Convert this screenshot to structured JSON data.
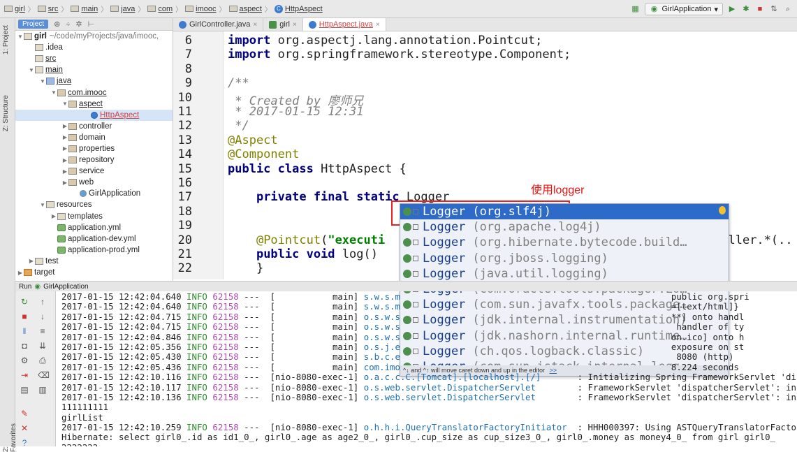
{
  "breadcrumb": [
    "girl",
    "src",
    "main",
    "java",
    "com",
    "imooc",
    "aspect",
    "HttpAspect"
  ],
  "run_config": "GirlApplication",
  "left_tabs": [
    "1: Project",
    "Z: Structure",
    "2: Favorites"
  ],
  "project_panel": {
    "tab": "Project",
    "tree": [
      {
        "label": "girl",
        "suffix": "~/code/myProjects/java/imooc,",
        "icon": "folder",
        "indent": 0,
        "arrow": "▼",
        "bold": true
      },
      {
        "label": ".idea",
        "icon": "folder",
        "indent": 1,
        "arrow": ""
      },
      {
        "label": "src",
        "icon": "folder",
        "indent": 1,
        "arrow": "",
        "underline": true
      },
      {
        "label": "main",
        "icon": "folder",
        "indent": 1,
        "arrow": "▼",
        "underline": true
      },
      {
        "label": "java",
        "icon": "src",
        "indent": 2,
        "arrow": "▼",
        "underline": true
      },
      {
        "label": "com.imooc",
        "icon": "pkg",
        "indent": 3,
        "arrow": "▼",
        "underline": true
      },
      {
        "label": "aspect",
        "icon": "pkg",
        "indent": 4,
        "arrow": "▼",
        "underline": true
      },
      {
        "label": "HttpAspect",
        "icon": "cls",
        "indent": 6,
        "arrow": "",
        "underline": true,
        "selected": true
      },
      {
        "label": "controller",
        "icon": "pkg",
        "indent": 4,
        "arrow": "▶"
      },
      {
        "label": "domain",
        "icon": "pkg",
        "indent": 4,
        "arrow": "▶"
      },
      {
        "label": "properties",
        "icon": "pkg",
        "indent": 4,
        "arrow": "▶"
      },
      {
        "label": "repository",
        "icon": "pkg",
        "indent": 4,
        "arrow": "▶"
      },
      {
        "label": "service",
        "icon": "pkg",
        "indent": 4,
        "arrow": "▶"
      },
      {
        "label": "web",
        "icon": "pkg",
        "indent": 4,
        "arrow": "▶"
      },
      {
        "label": "GirlApplication",
        "icon": "app",
        "indent": 5,
        "arrow": ""
      },
      {
        "label": "resources",
        "icon": "folder",
        "indent": 2,
        "arrow": "▼"
      },
      {
        "label": "templates",
        "icon": "folder",
        "indent": 3,
        "arrow": "▶"
      },
      {
        "label": "application.yml",
        "icon": "yml",
        "indent": 3,
        "arrow": ""
      },
      {
        "label": "application-dev.yml",
        "icon": "yml",
        "indent": 3,
        "arrow": ""
      },
      {
        "label": "application-prod.yml",
        "icon": "yml",
        "indent": 3,
        "arrow": ""
      },
      {
        "label": "test",
        "icon": "folder",
        "indent": 1,
        "arrow": "▶"
      },
      {
        "label": "target",
        "icon": "tgt",
        "indent": 0,
        "arrow": "▶"
      }
    ]
  },
  "editor_tabs": [
    {
      "label": "GirlController.java",
      "icon": "c",
      "active": false
    },
    {
      "label": "girl",
      "icon": "m",
      "active": false
    },
    {
      "label": "HttpAspect.java",
      "icon": "c",
      "active": true
    }
  ],
  "code_lines": [
    {
      "n": "6",
      "html": "<span class='kw'>import</span> org.aspectj.lang.annotation.Pointcut;"
    },
    {
      "n": "7",
      "html": "<span class='kw'>import</span> org.springframework.stereotype.Component;"
    },
    {
      "n": "8",
      "html": ""
    },
    {
      "n": "9",
      "html": "<span class='cm'>/**</span>"
    },
    {
      "n": "10",
      "html": "<span class='cm'> * Created by 廖师兄</span>"
    },
    {
      "n": "11",
      "html": "<span class='cm'> * 2017-01-15 12:31</span>"
    },
    {
      "n": "12",
      "html": "<span class='cm'> */</span>"
    },
    {
      "n": "13",
      "html": "<span class='an'>@Aspect</span>"
    },
    {
      "n": "14",
      "html": "<span class='an'>@Component</span>"
    },
    {
      "n": "15",
      "html": "<span class='kw'>public class</span> HttpAspect {"
    },
    {
      "n": "16",
      "html": ""
    },
    {
      "n": "17",
      "html": "    <span class='kw'>private final static</span> Logger"
    },
    {
      "n": "18",
      "html": ""
    },
    {
      "n": "19",
      "html": ""
    },
    {
      "n": "20",
      "html": "    <span class='an'>@Pointcut</span>(<span class='str'>\"executi</span>                                              roller.*(.."
    },
    {
      "n": "21",
      "html": "    <span class='kw'>public void</span> log()"
    },
    {
      "n": "22",
      "html": "    }"
    }
  ],
  "annotation_text": "使用logger",
  "completion": {
    "items": [
      {
        "name": "Logger",
        "pkg": "(org.slf4j)",
        "selected": true
      },
      {
        "name": "Logger",
        "pkg": "(org.apache.log4j)"
      },
      {
        "name": "Logger",
        "pkg": "(org.hibernate.bytecode.build…"
      },
      {
        "name": "Logger",
        "pkg": "(org.jboss.logging)"
      },
      {
        "name": "Logger",
        "pkg": "(java.util.logging)"
      },
      {
        "name": "Logger",
        "pkg": "(com.oracle.tools.packager.Lo…"
      },
      {
        "name": "Logger",
        "pkg": "(com.sun.javafx.tools.package…"
      },
      {
        "name": "Logger",
        "pkg": "(jdk.internal.instrumentation)"
      },
      {
        "name": "Logger",
        "pkg": "(jdk.nashorn.internal.runtime…"
      },
      {
        "name": "Logger",
        "pkg": "(ch.qos.logback.classic)"
      },
      {
        "name": "Logger",
        "pkg": "(com.sun.istack.internal.logg…"
      }
    ],
    "footer": "^↓ and ^↑ will move caret down and up in the editor",
    "footer_link": ">>"
  },
  "run_panel": {
    "title": "Run",
    "config": "GirlApplication",
    "lines": [
      {
        "ts": "2017-01-15 12:42:04.640",
        "lvl": "INFO",
        "pid": "62158",
        "thread": "---  [           main]",
        "logger": "s.w.s.m",
        "msg": "                                                   public org.spri"
      },
      {
        "ts": "2017-01-15 12:42:04.640",
        "lvl": "INFO",
        "pid": "62158",
        "thread": "---  [           main]",
        "logger": "s.w.s.m",
        "msg": "                                                   =[text/html]}"
      },
      {
        "ts": "2017-01-15 12:42:04.715",
        "lvl": "INFO",
        "pid": "62158",
        "thread": "---  [           main]",
        "logger": "o.s.w.s",
        "msg": "                                                   **] onto handl"
      },
      {
        "ts": "2017-01-15 12:42:04.715",
        "lvl": "INFO",
        "pid": "62158",
        "thread": "---  [           main]",
        "logger": "o.s.w.s",
        "msg": "                                                    handler of ty"
      },
      {
        "ts": "2017-01-15 12:42:04.846",
        "lvl": "INFO",
        "pid": "62158",
        "thread": "---  [           main]",
        "logger": "o.s.w.s",
        "msg": "                                                   on.ico] onto h"
      },
      {
        "ts": "2017-01-15 12:42:05.356",
        "lvl": "INFO",
        "pid": "62158",
        "thread": "---  [           main]",
        "logger": "o.s.j.e",
        "msg": "                                                   exposure on st"
      },
      {
        "ts": "2017-01-15 12:42:05.430",
        "lvl": "INFO",
        "pid": "62158",
        "thread": "---  [           main]",
        "logger": "s.b.c.e",
        "msg": "                                                    8080 (http)"
      },
      {
        "ts": "2017-01-15 12:42:05.436",
        "lvl": "INFO",
        "pid": "62158",
        "thread": "---  [           main]",
        "logger": "com.imo",
        "msg": "                                                   8.224 seconds"
      },
      {
        "ts": "2017-01-15 12:42:10.116",
        "lvl": "INFO",
        "pid": "62158",
        "thread": "---  [nio-8080-exec-1]",
        "logger": "o.a.c.c.C.[Tomcat].[localhost].[/]",
        "msg": "      : Initializing Spring FrameworkServlet 'di"
      },
      {
        "ts": "2017-01-15 12:42:10.117",
        "lvl": "INFO",
        "pid": "62158",
        "thread": "---  [nio-8080-exec-1]",
        "logger": "o.s.web.servlet.DispatcherServlet",
        "msg": "       : FrameworkServlet 'dispatcherServlet': in"
      },
      {
        "ts": "2017-01-15 12:42:10.136",
        "lvl": "INFO",
        "pid": "62158",
        "thread": "---  [nio-8080-exec-1]",
        "logger": "o.s.web.servlet.DispatcherServlet",
        "msg": "       : FrameworkServlet 'dispatcherServlet': in"
      },
      {
        "plain": "111111111"
      },
      {
        "plain": "girlList"
      },
      {
        "ts": "2017-01-15 12:42:10.259",
        "lvl": "INFO",
        "pid": "62158",
        "thread": "---  [nio-8080-exec-1]",
        "logger": "o.h.h.i.QueryTranslatorFactoryInitiator",
        "msg": " : HHH000397: Using ASTQueryTranslatorFacto"
      },
      {
        "plain": "Hibernate: select girl0_.id as id1_0_, girl0_.age as age2_0_, girl0_.cup_size as cup_size3_0_, girl0_.money as money4_0_ from girl girl0_"
      },
      {
        "plain": "2222222"
      }
    ]
  }
}
